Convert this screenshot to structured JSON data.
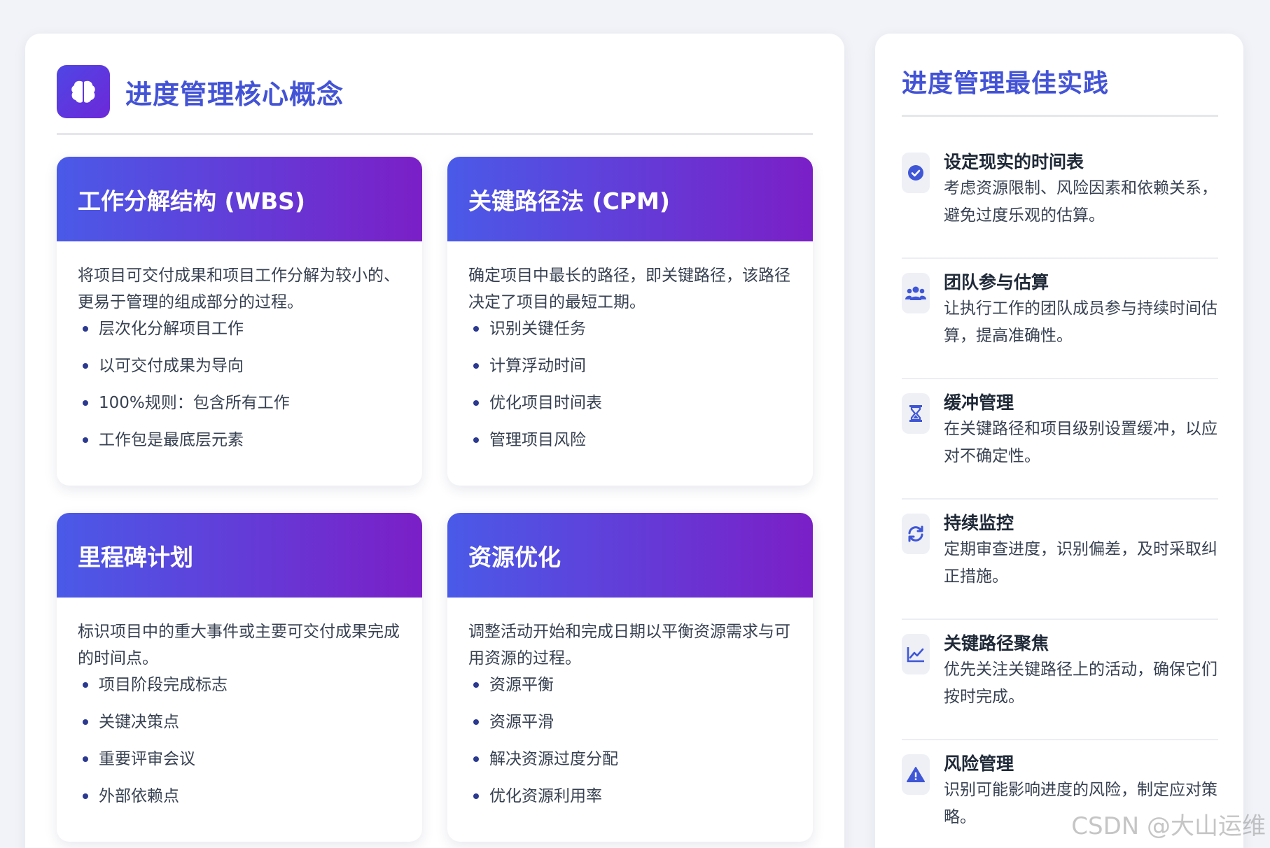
{
  "left": {
    "title": "进度管理核心概念",
    "cards": [
      {
        "title": "工作分解结构 (WBS)",
        "desc": "将项目可交付成果和项目工作分解为较小的、更易于管理的组成部分的过程。",
        "items": [
          "层次化分解项目工作",
          "以可交付成果为导向",
          "100%规则：包含所有工作",
          "工作包是最底层元素"
        ]
      },
      {
        "title": "关键路径法 (CPM)",
        "desc": "确定项目中最长的路径，即关键路径，该路径决定了项目的最短工期。",
        "items": [
          "识别关键任务",
          "计算浮动时间",
          "优化项目时间表",
          "管理项目风险"
        ]
      },
      {
        "title": "里程碑计划",
        "desc": "标识项目中的重大事件或主要可交付成果完成的时间点。",
        "items": [
          "项目阶段完成标志",
          "关键决策点",
          "重要评审会议",
          "外部依赖点"
        ]
      },
      {
        "title": "资源优化",
        "desc": "调整活动开始和完成日期以平衡资源需求与可用资源的过程。",
        "items": [
          "资源平衡",
          "资源平滑",
          "解决资源过度分配",
          "优化资源利用率"
        ]
      }
    ]
  },
  "right": {
    "title": "进度管理最佳实践",
    "practices": [
      {
        "icon": "check-circle-icon",
        "title": "设定现实的时间表",
        "desc": "考虑资源限制、风险因素和依赖关系，避免过度乐观的估算。"
      },
      {
        "icon": "users-icon",
        "title": "团队参与估算",
        "desc": "让执行工作的团队成员参与持续时间估算，提高准确性。"
      },
      {
        "icon": "hourglass-icon",
        "title": "缓冲管理",
        "desc": "在关键路径和项目级别设置缓冲，以应对不确定性。"
      },
      {
        "icon": "sync-icon",
        "title": "持续监控",
        "desc": "定期审查进度，识别偏差，及时采取纠正措施。"
      },
      {
        "icon": "chart-line-icon",
        "title": "关键路径聚焦",
        "desc": "优先关注关键路径上的活动，确保它们按时完成。"
      },
      {
        "icon": "warning-icon",
        "title": "风险管理",
        "desc": "识别可能影响进度的风险，制定应对策略。"
      }
    ]
  },
  "watermark": "CSDN @大山运维",
  "colors": {
    "accent": "#4353d6",
    "gradient_start": "#4a5ae8",
    "gradient_end": "#7b1fc7"
  }
}
